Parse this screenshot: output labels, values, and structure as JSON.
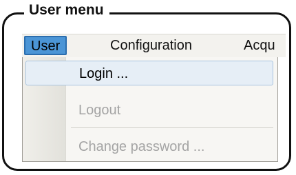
{
  "frame": {
    "title": "User menu"
  },
  "menubar": {
    "items": [
      {
        "label": "User",
        "active": true
      },
      {
        "label": "Configuration",
        "active": false
      },
      {
        "label": "Acqu",
        "active": false
      }
    ]
  },
  "dropdown": {
    "items": [
      {
        "label": "Login ...",
        "enabled": true
      },
      {
        "label": "Logout",
        "enabled": false
      },
      {
        "label": "Change password ...",
        "enabled": false
      }
    ]
  },
  "colors": {
    "menu_highlight": "#4b95d6",
    "item_highlight": "#e6eef6",
    "disabled_text": "#a4a4a4"
  }
}
